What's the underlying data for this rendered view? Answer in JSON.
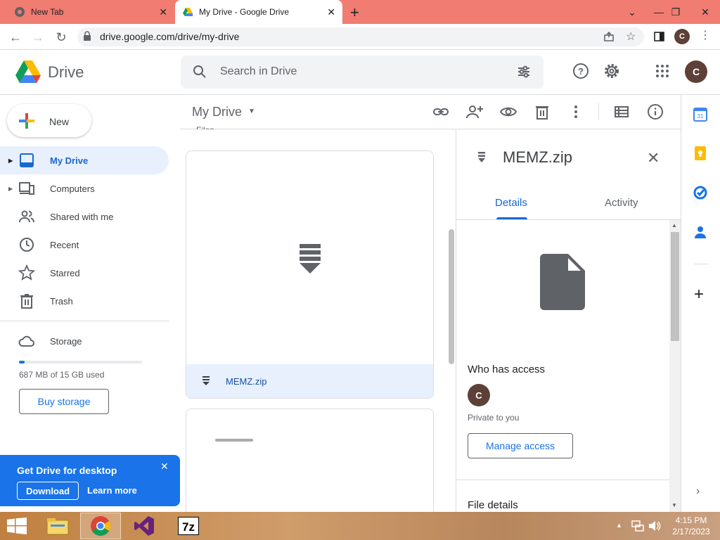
{
  "browser": {
    "tabs": [
      {
        "title": "New Tab"
      },
      {
        "title": "My Drive - Google Drive"
      }
    ],
    "url": "drive.google.com/drive/my-drive",
    "profile_initial": "C"
  },
  "drive": {
    "logo_text": "Drive",
    "search_placeholder": "Search in Drive",
    "account_initial": "C"
  },
  "sidebar": {
    "new_label": "New",
    "items": [
      {
        "label": "My Drive"
      },
      {
        "label": "Computers"
      },
      {
        "label": "Shared with me"
      },
      {
        "label": "Recent"
      },
      {
        "label": "Starred"
      },
      {
        "label": "Trash"
      },
      {
        "label": "Storage"
      }
    ],
    "storage_used": "687 MB of 15 GB used",
    "storage_fraction": 0.045,
    "buy_storage": "Buy storage",
    "promo": {
      "title": "Get Drive for desktop",
      "download": "Download",
      "learn_more": "Learn more"
    }
  },
  "main": {
    "title": "My Drive",
    "section_label": "Files",
    "files": [
      {
        "name": "MEMZ.zip"
      }
    ]
  },
  "details": {
    "file_name": "MEMZ.zip",
    "tab_details": "Details",
    "tab_activity": "Activity",
    "who_has_access": "Who has access",
    "owner_initial": "C",
    "private_text": "Private to you",
    "manage_access": "Manage access",
    "file_details": "File details"
  },
  "taskbar": {
    "time": "4:15 PM",
    "date": "2/17/2023"
  },
  "colors": {
    "tabstrip": "#f07c72",
    "accent": "#1a73e8",
    "selected_nav": "#e8f0fe",
    "avatar": "#5d4037"
  }
}
